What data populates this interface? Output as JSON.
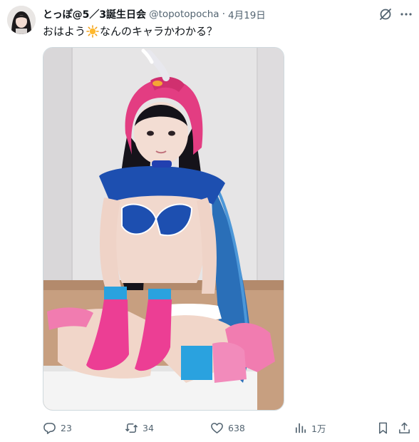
{
  "tweet": {
    "display_name": "とっぽ@5／3誕生日会",
    "handle": "@topotopocha",
    "separator": "·",
    "date": "4月19日",
    "text_before": "おはよう",
    "text_emoji": "sun-emoji",
    "text_after": "なんのキャラかわかる？"
  },
  "actions": {
    "replies": "23",
    "reposts": "34",
    "likes": "638",
    "views": "1万"
  },
  "colors": {
    "text": "#0f1419",
    "muted": "#536471",
    "border": "#cfd9de"
  }
}
